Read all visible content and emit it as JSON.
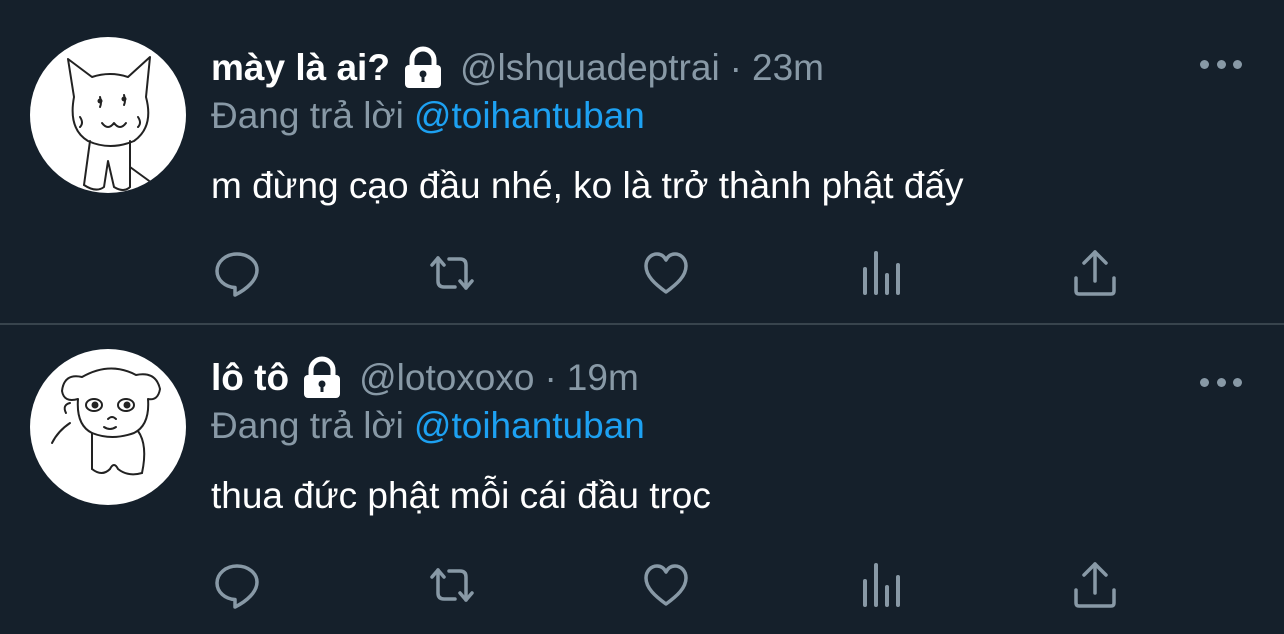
{
  "tweets": [
    {
      "name": "mày là ai?",
      "handle": "@lshquadeptrai",
      "separator": "·",
      "time": "23m",
      "replying_label": "Đang trả lời",
      "replying_to": "@toihantuban",
      "text": "m đừng cạo đầu nhé, ko là trở thành phật đấy",
      "avatar": "cat-drawing-avatar"
    },
    {
      "name": "lô tô",
      "handle": "@lotoxoxo",
      "separator": "·",
      "time": "19m",
      "replying_label": "Đang trả lời",
      "replying_to": "@toihantuban",
      "text": "thua đức phật mỗi cái đầu trọc",
      "avatar": "dog-drawing-avatar"
    }
  ],
  "icons": {
    "lock": "lock-icon",
    "more": "more-icon",
    "reply": "reply-icon",
    "retweet": "retweet-icon",
    "like": "heart-icon",
    "analytics": "analytics-icon",
    "share": "share-icon"
  },
  "colors": {
    "background": "#15202b",
    "text": "#ffffff",
    "muted": "#8899a6",
    "accent": "#1da1f2",
    "divider": "#38444d"
  }
}
